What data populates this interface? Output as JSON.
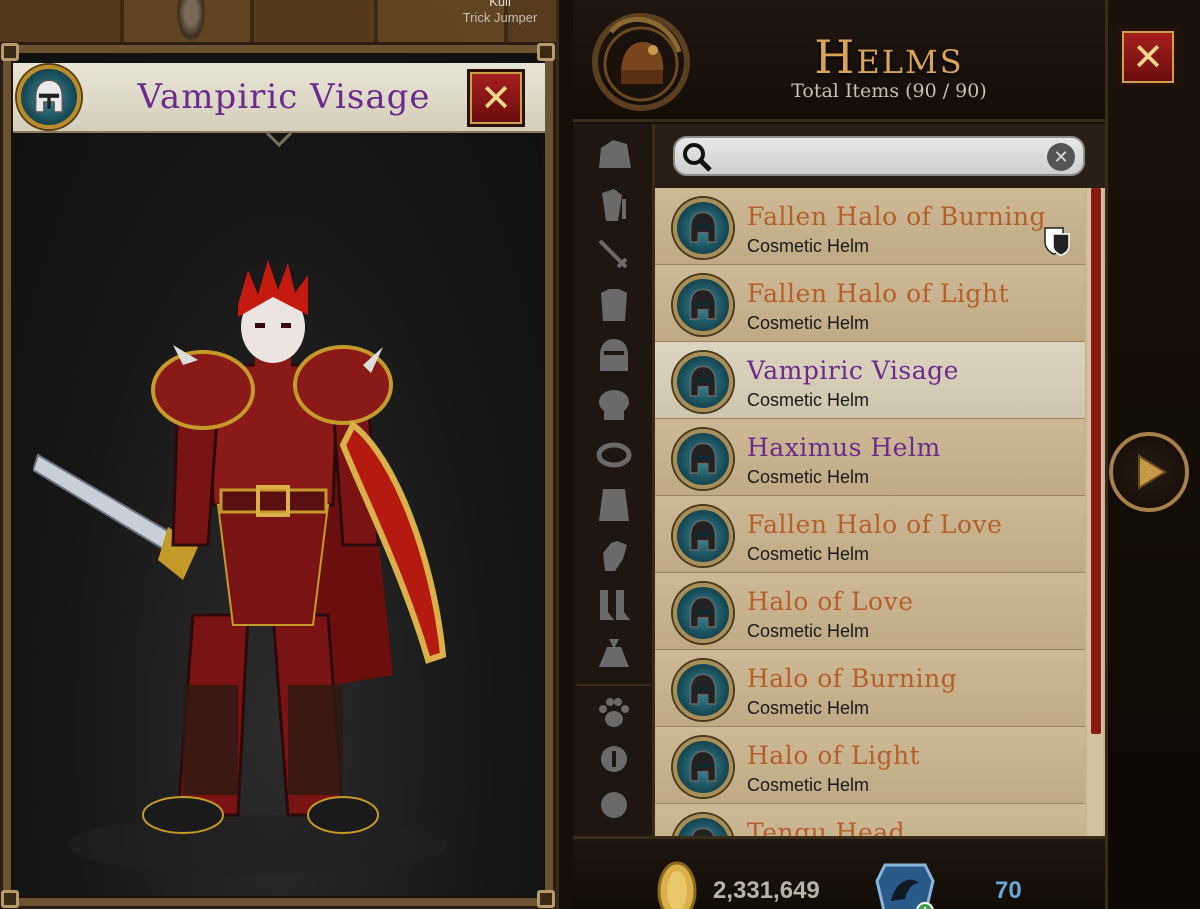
{
  "scene": {
    "npc_name": "Kull",
    "npc_title": "Trick Jumper"
  },
  "preview": {
    "title": "Vampiric Visage",
    "close_label": "✕",
    "title_color": "#6b2a8c"
  },
  "inventory": {
    "title": "Helms",
    "total_items": "Total Items (90 / 90)",
    "close_label": "✕",
    "search": {
      "value": "",
      "placeholder": ""
    },
    "categories": [
      "helmet-bag-icon",
      "armor-set-icon",
      "sword-icon",
      "chest-armor-icon",
      "helm-icon",
      "shoulder-armor-icon",
      "belt-ring-icon",
      "cape-icon",
      "glove-icon",
      "boots-icon",
      "loot-bag-icon",
      "pet-paw-icon",
      "info-icon",
      "misc-orb-icon"
    ],
    "items": [
      {
        "name": "Fallen Halo of Burning",
        "type": "Cosmetic Helm",
        "color": "orange",
        "badge": "cosmetic-mask-icon"
      },
      {
        "name": "Fallen Halo of Light",
        "type": "Cosmetic Helm",
        "color": "orange"
      },
      {
        "name": "Vampiric Visage",
        "type": "Cosmetic Helm",
        "color": "purple",
        "selected": true
      },
      {
        "name": "Haximus Helm",
        "type": "Cosmetic Helm",
        "color": "purple"
      },
      {
        "name": "Fallen Halo of Love",
        "type": "Cosmetic Helm",
        "color": "orange"
      },
      {
        "name": "Halo of Love",
        "type": "Cosmetic Helm",
        "color": "orange"
      },
      {
        "name": "Halo of Burning",
        "type": "Cosmetic Helm",
        "color": "orange"
      },
      {
        "name": "Halo of Light",
        "type": "Cosmetic Helm",
        "color": "orange"
      },
      {
        "name": "Tengu Head",
        "type": "",
        "color": "orange"
      }
    ],
    "currency": {
      "gold": "2,331,649",
      "dragon_gems": "70"
    }
  },
  "colors": {
    "rare_orange": "#b5602a",
    "epic_purple": "#6b2a8c",
    "gold_text": "#d9a45a",
    "gem_blue": "#6aa8d8"
  }
}
